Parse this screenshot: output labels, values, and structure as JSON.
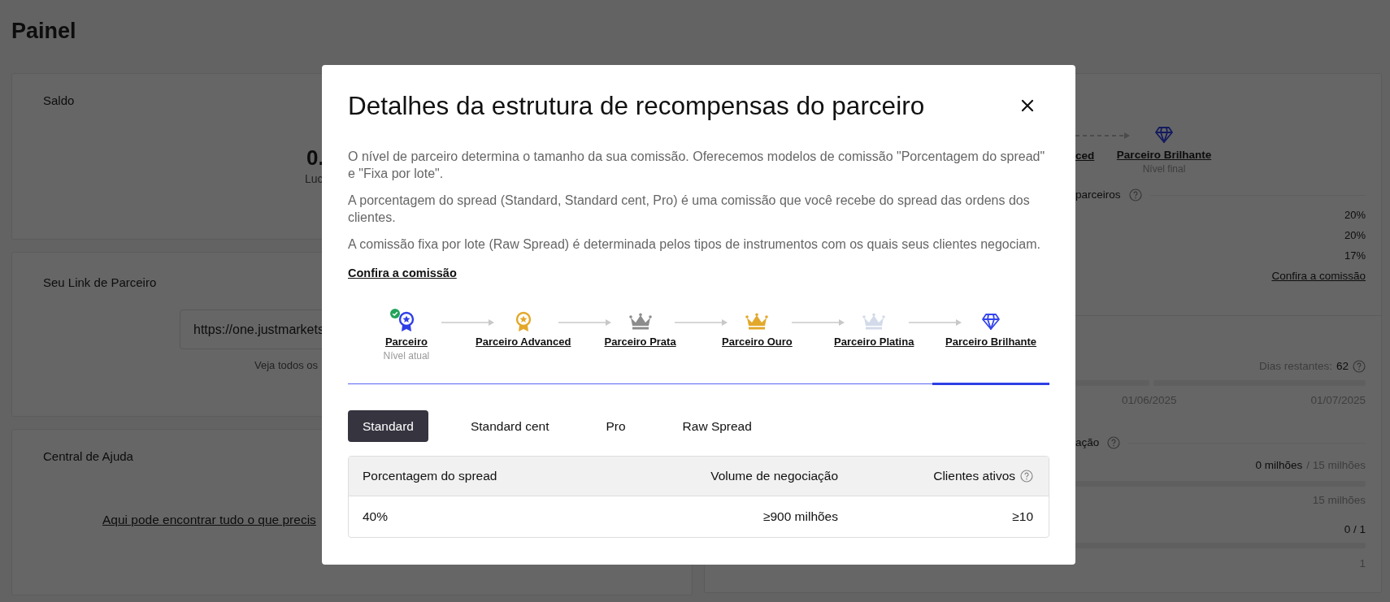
{
  "page": {
    "title": "Painel"
  },
  "background": {
    "balance_card": {
      "title": "Saldo",
      "amount": "0.",
      "amount_label": "Luc"
    },
    "link_card": {
      "title": "Seu Link de Parceiro",
      "link_value": "https://one.justmarkets",
      "hint": "Veja todos os"
    },
    "help_card": {
      "title": "Central de Ajuda",
      "link": "Aqui pode encontrar tudo o que precis"
    },
    "levels_card": {
      "level_partial": "ced",
      "final_level": {
        "label": "Parceiro Brilhante",
        "sublabel": "Nível final"
      },
      "section_title": "parceiros",
      "rates": [
        "20%",
        "20%",
        "17%"
      ],
      "link": "Confira a comissão"
    },
    "progress_card": {
      "days_label": "Dias restantes:",
      "days_value": "62",
      "dates": [
        "01/06/2025",
        "01/07/2025"
      ],
      "section_title": "ação",
      "volume_value": "0 milhões",
      "volume_target": "/ 15 milhões",
      "volume_max": "15 milhões",
      "clients_value": "0 / 1",
      "clients_max": "1"
    }
  },
  "modal": {
    "title": "Detalhes da estrutura de recompensas do parceiro",
    "paragraphs": [
      "O nível de parceiro determina o tamanho da sua comissão. Oferecemos modelos de comissão \"Porcentagem do spread\" e \"Fixa por lote\".",
      "A porcentagem do spread (Standard, Standard cent, Pro) é uma comissão que você recebe do spread das ordens dos clientes.",
      "A comissão fixa por lote (Raw Spread) é determinada pelos tipos de instrumentos com os quais seus clientes negociam."
    ],
    "link": "Confira a comissão",
    "levels": [
      {
        "label": "Parceiro",
        "kind": "medal",
        "color": "#2f3fe6",
        "current": true,
        "sublabel": "Nível atual",
        "selected": false
      },
      {
        "label": "Parceiro Advanced",
        "kind": "medal",
        "color": "#e3a82b",
        "current": false,
        "selected": false
      },
      {
        "label": "Parceiro Prata",
        "kind": "crown",
        "color": "#8c8c8c",
        "current": false,
        "selected": false
      },
      {
        "label": "Parceiro Ouro",
        "kind": "crown",
        "color": "#e3a82b",
        "current": false,
        "selected": false
      },
      {
        "label": "Parceiro Platina",
        "kind": "crown",
        "color": "#d3dbea",
        "current": false,
        "selected": false
      },
      {
        "label": "Parceiro Brilhante",
        "kind": "diamond",
        "color": "#3344ee",
        "current": false,
        "selected": true
      }
    ],
    "tabs": [
      {
        "label": "Standard",
        "selected": true
      },
      {
        "label": "Standard cent",
        "selected": false
      },
      {
        "label": "Pro",
        "selected": false
      },
      {
        "label": "Raw Spread",
        "selected": false
      }
    ],
    "table": {
      "columns": [
        "Porcentagem do spread",
        "Volume de negociação",
        "Clientes ativos"
      ],
      "rows": [
        [
          "40%",
          "≥900 milhões",
          "≥10"
        ]
      ]
    }
  }
}
